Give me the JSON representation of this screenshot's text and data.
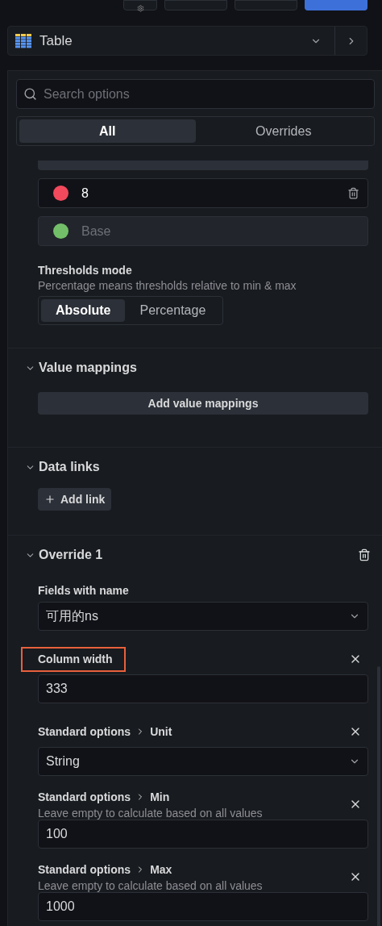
{
  "toolbar": {
    "buttons": [
      {
        "kind": "icon"
      },
      {
        "kind": "plain"
      },
      {
        "kind": "plain"
      },
      {
        "kind": "primary"
      }
    ]
  },
  "visualization": {
    "name": "Table"
  },
  "search": {
    "placeholder": "Search options"
  },
  "tabs": [
    {
      "label": "All",
      "selected": true
    },
    {
      "label": "Overrides",
      "selected": false
    }
  ],
  "thresholds": [
    {
      "value": "8",
      "color": "#f2495c",
      "removable": true
    },
    {
      "value": "Base",
      "color": "#73bf69",
      "removable": false
    }
  ],
  "thresholds_mode": {
    "label": "Thresholds mode",
    "description": "Percentage means thresholds relative to min & max",
    "options": [
      {
        "label": "Absolute",
        "selected": true
      },
      {
        "label": "Percentage",
        "selected": false
      }
    ]
  },
  "sections": [
    {
      "title": "Value mappings",
      "expanded": true,
      "kind": "wide",
      "button": "Add value mappings"
    },
    {
      "title": "Data links",
      "expanded": true,
      "kind": "add",
      "button": "Add link"
    }
  ],
  "override": {
    "title": "Override 1",
    "expanded": true,
    "matcher": {
      "label": "Fields with name",
      "value": "可用的ns"
    },
    "properties": [
      {
        "path": [
          "Column width"
        ],
        "value": "333",
        "kind": "input",
        "highlighted": true
      },
      {
        "path": [
          "Standard options",
          "Unit"
        ],
        "value": "String",
        "kind": "select",
        "highlighted": false
      },
      {
        "path": [
          "Standard options",
          "Min"
        ],
        "description": "Leave empty to calculate based on all values",
        "value": "100",
        "kind": "input",
        "highlighted": false
      },
      {
        "path": [
          "Standard options",
          "Max"
        ],
        "description": "Leave empty to calculate based on all values",
        "value": "1000",
        "kind": "input",
        "highlighted": false
      }
    ]
  }
}
